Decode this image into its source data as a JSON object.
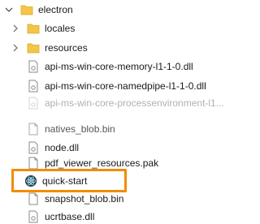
{
  "tree": {
    "root": {
      "label": "electron",
      "icon": "folder-icon",
      "expanded": true
    },
    "folders": [
      {
        "label": "locales",
        "icon": "folder-icon"
      },
      {
        "label": "resources",
        "icon": "folder-icon"
      }
    ],
    "files": [
      {
        "label": "api-ms-win-core-memory-l1-1-0.dll",
        "icon": "dll-file-icon"
      },
      {
        "label": "api-ms-win-core-namedpipe-l1-1-0.dll",
        "icon": "dll-file-icon"
      },
      {
        "label": "api-ms-win-core-processenvironment-l1...",
        "icon": "dll-file-icon"
      },
      {
        "label": "natives_blob.bin",
        "icon": "file-icon"
      },
      {
        "label": "node.dll",
        "icon": "dll-file-icon"
      },
      {
        "label": "pdf_viewer_resources.pak",
        "icon": "file-icon"
      },
      {
        "label": "quick-start",
        "icon": "electron-app-icon",
        "highlighted": true
      },
      {
        "label": "snapshot_blob.bin",
        "icon": "file-icon"
      },
      {
        "label": "ucrtbase.dll",
        "icon": "dll-file-icon"
      }
    ]
  },
  "colors": {
    "folder": "#f4c645",
    "highlight_border": "#f28c00",
    "electron_icon": "#47848f"
  }
}
